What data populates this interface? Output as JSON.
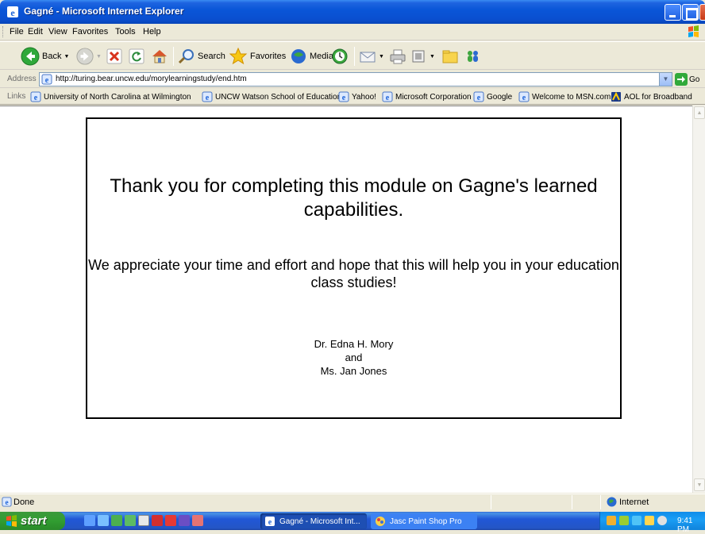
{
  "window": {
    "title": "Gagné - Microsoft Internet Explorer"
  },
  "menu": [
    "File",
    "Edit",
    "View",
    "Favorites",
    "Tools",
    "Help"
  ],
  "toolbar": {
    "back_label": "Back",
    "search_label": "Search",
    "favorites_label": "Favorites",
    "media_label": "Media"
  },
  "address": {
    "label": "Address",
    "url": "http://turing.bear.uncw.edu/morylearningstudy/end.htm",
    "go_label": "Go"
  },
  "links": {
    "label": "Links",
    "items": [
      "University of North Carolina at Wilmington",
      "UNCW Watson School of Education",
      "Yahoo!",
      "Microsoft Corporation",
      "Google",
      "Welcome to MSN.com",
      "AOL for Broadband"
    ]
  },
  "content": {
    "thanks": "Thank you for completing this module on Gagne's learned capabilities.",
    "appreciate": "We appreciate your time and effort and hope that this will help you in your education class studies!",
    "author1": "Dr. Edna H. Mory",
    "and": "and",
    "author2": "Ms. Jan Jones"
  },
  "status": {
    "text": "Done",
    "zone": "Internet"
  },
  "taskbar": {
    "start_label": "start",
    "tasks": [
      "Gagné - Microsoft Int...",
      "Jasc Paint Shop Pro"
    ],
    "clock": "9:41 PM"
  }
}
